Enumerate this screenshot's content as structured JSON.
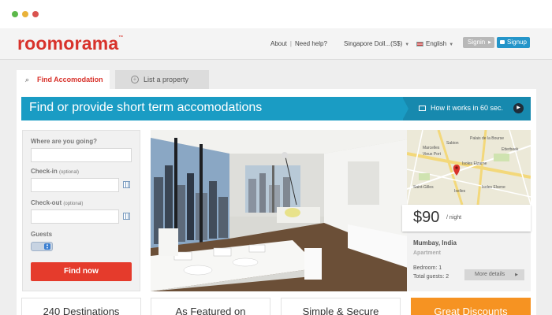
{
  "window": {
    "controls": [
      "close",
      "minimize",
      "maximize"
    ]
  },
  "header": {
    "logo": "roomorama",
    "logo_tm": "™",
    "links": [
      "About",
      "Need help?"
    ],
    "link_separator": "|",
    "currency": "Singapore Doll...(S$)",
    "language": "English",
    "signin": "Signin",
    "signup": "Signup"
  },
  "tabs": [
    {
      "label": "Find Accomodation",
      "active": true,
      "icon": "search-icon"
    },
    {
      "label": "List a property",
      "active": false,
      "icon": "plus-circle-icon"
    }
  ],
  "banner": {
    "title": "Find or provide short term accomodations",
    "how_link": "How it works in 60 sec."
  },
  "search_form": {
    "destination_label": "Where are you going?",
    "destination_value": "",
    "checkin_label": "Check-in",
    "checkin_optional": "(optional)",
    "checkin_value": "",
    "checkout_label": "Check-out",
    "checkout_optional": "(optional)",
    "checkout_value": "",
    "guests_label": "Guests",
    "submit": "Find now"
  },
  "map": {
    "labels": [
      "Sabion",
      "Marcelles",
      "Vieux Port",
      "Palais de la Bourse",
      "Isoles Elzarne",
      "Etterbeek",
      "Saint-Gilles",
      "Ixelles",
      "Isoles Elsene"
    ]
  },
  "listing": {
    "price": "$90",
    "per": "/ night",
    "city": "Mumbay, India",
    "type": "Apartment",
    "bedroom": "Bedroom: 1",
    "guests": "Total guests: 2",
    "more": "More details"
  },
  "features": [
    "240 Destinations",
    "As Featured on",
    "Simple & Secure",
    "Great Discounts"
  ],
  "colors": {
    "brand_red": "#d8322b",
    "banner_blue": "#1a9cc4",
    "button_red": "#e53b2c",
    "signup_blue": "#2495c9",
    "discount_orange": "#f69322"
  }
}
